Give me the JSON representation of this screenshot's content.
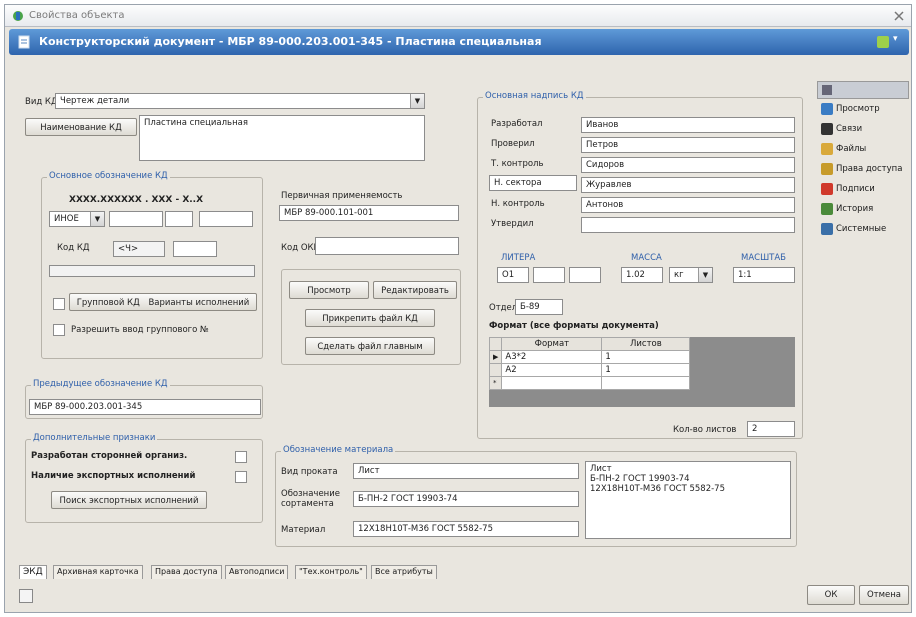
{
  "window": {
    "title": "Свойства объекта"
  },
  "doc_header": {
    "title": "Конструкторский документ - МБР 89-000.203.001-345 - Пластина специальная"
  },
  "vid_kd": {
    "label": "Вид КД",
    "value": "Чертеж детали"
  },
  "naim_kd": {
    "button": "Наименование КД",
    "value": "Пластина специальная"
  },
  "osn_oboz": {
    "title": "Основное обозначение КД",
    "mask": "ХХХХ.ХХХХХХ . ХХХ - Х..Х",
    "prefix": "ИНОЕ",
    "kod_label": "Код КД",
    "kod_value": "<Ч>",
    "group_btn": "Групповой КД",
    "variants_btn": "Варианты исполнений",
    "allow_label": "Разрешить ввод группового №"
  },
  "perv": {
    "label": "Первичная применяемость",
    "value": "МБР 89-000.101-001",
    "okp_label": "Код ОКП"
  },
  "actions": {
    "view": "Просмотр",
    "edit": "Редактировать",
    "attach": "Прикрепить файл КД",
    "make_main": "Сделать файл главным"
  },
  "pred_oboz": {
    "title": "Предыдущее обозначение КД",
    "value": "МБР 89-000.203.001-345"
  },
  "dop": {
    "title": "Дополнительные признаки",
    "dev": "Разработан сторонней организ.",
    "exp": "Наличие экспортных исполнений",
    "btn": "Поиск экспортных исполнений"
  },
  "material": {
    "title": "Обозначение материала",
    "vid_label": "Вид проката",
    "vid_value": "Лист",
    "oboz_label": "Обозначение сортамента",
    "oboz_value": "Б-ПН-2 ГОСТ 19903-74",
    "mat_label": "Материал",
    "mat_value": "12Х18Н10Т-М36 ГОСТ 5582-75",
    "memo": [
      "Лист",
      "Б-ПН-2 ГОСТ 19903-74",
      "12Х18Н10Т-М36 ГОСТ 5582-75"
    ]
  },
  "stamp": {
    "title": "Основная надпись КД",
    "rows": [
      {
        "role": "Разработал",
        "name": "Иванов"
      },
      {
        "role": "Проверил",
        "name": "Петров"
      },
      {
        "role": "Т. контроль",
        "name": "Сидоров"
      },
      {
        "role": "Н. сектора",
        "name": "Журавлев"
      },
      {
        "role": "Н. контроль",
        "name": "Антонов"
      },
      {
        "role": "Утвердил",
        "name": ""
      }
    ]
  },
  "litera": {
    "label": "ЛИТЕРА",
    "value": "О1"
  },
  "massa": {
    "label": "МАССА",
    "value": "1.02",
    "unit": "кг"
  },
  "masshtab": {
    "label": "МАСШТАБ",
    "value": "1:1"
  },
  "otdel": {
    "label": "Отдел",
    "value": "Б-89"
  },
  "format": {
    "title": "Формат (все форматы документа)",
    "col_format": "Формат",
    "col_sheets": "Листов",
    "rows": [
      {
        "format": "А3*2",
        "sheets": "1"
      },
      {
        "format": "А2",
        "sheets": "1"
      }
    ],
    "count_label": "Кол-во листов",
    "count_value": "2"
  },
  "sidebar": {
    "items": [
      {
        "label": "Просмотр",
        "icon": "magnifier-icon",
        "color": "#3a7cc4"
      },
      {
        "label": "Связи",
        "icon": "link-icon",
        "color": "#333333"
      },
      {
        "label": "Файлы",
        "icon": "folder-icon",
        "color": "#d9a93a"
      },
      {
        "label": "Права доступа",
        "icon": "key-icon",
        "color": "#c79b2a"
      },
      {
        "label": "Подписи",
        "icon": "pen-icon",
        "color": "#d0392b"
      },
      {
        "label": "История",
        "icon": "history-icon",
        "color": "#4a8a3a"
      },
      {
        "label": "Системные",
        "icon": "system-icon",
        "color": "#3a6fa8"
      }
    ]
  },
  "tabs": [
    "ЭКД",
    "Архивная карточка",
    "Права доступа",
    "Автоподписи",
    "\"Тех.контроль\"",
    "Все атрибуты"
  ],
  "footer": {
    "ok": "ОК",
    "cancel": "Отмена"
  }
}
